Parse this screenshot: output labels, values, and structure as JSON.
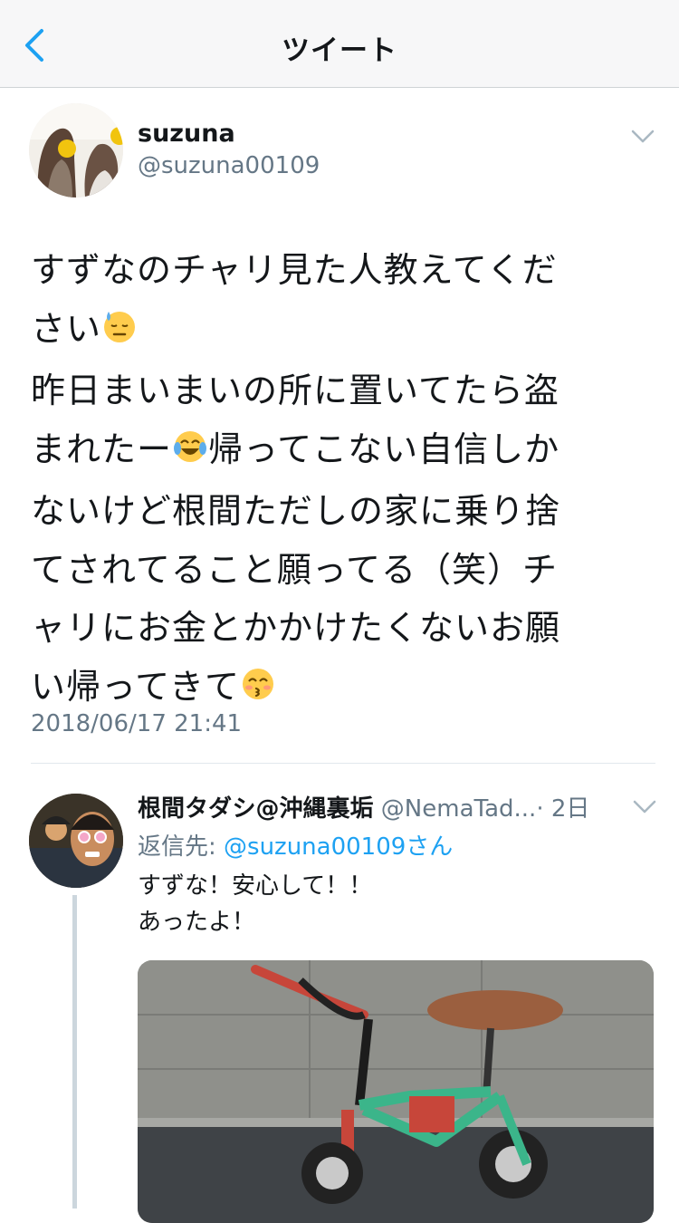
{
  "nav": {
    "title": "ツイート",
    "back_icon": "chevron-left-icon"
  },
  "main_tweet": {
    "display_name": "suzuna",
    "handle": "@suzuna00109",
    "line1": "すずなのチャリ見た人教えてくだ",
    "line2a": "さい",
    "line3": "昨日まいまいの所に置いてたら盗",
    "line4a": "まれたー",
    "line4b": "帰ってこない自信しか",
    "line5": "ないけど根間ただしの家に乗り捨",
    "line6": "てされてること願ってる（笑）チ",
    "line7": "ャリにお金とかかけたくないお願",
    "line8a": "い帰ってきて",
    "emoji1": "downcast-face-with-sweat",
    "emoji2": "face-with-tears-of-joy",
    "emoji3": "kissing-face-with-smiling-eyes",
    "timestamp": "2018/06/17 21:41"
  },
  "reply_tweet": {
    "display_name": "根間タダシ@沖縄裏垢",
    "handle": "@NemaTad...",
    "time": "· 2日",
    "reply_prefix": "返信先: ",
    "reply_mention": "@suzuna00109さん",
    "line1": "すずな！安心して！！",
    "line2": "あったよ！"
  },
  "colors": {
    "accent": "#1da1f2",
    "secondary_text": "#657786",
    "text": "#14171a"
  }
}
